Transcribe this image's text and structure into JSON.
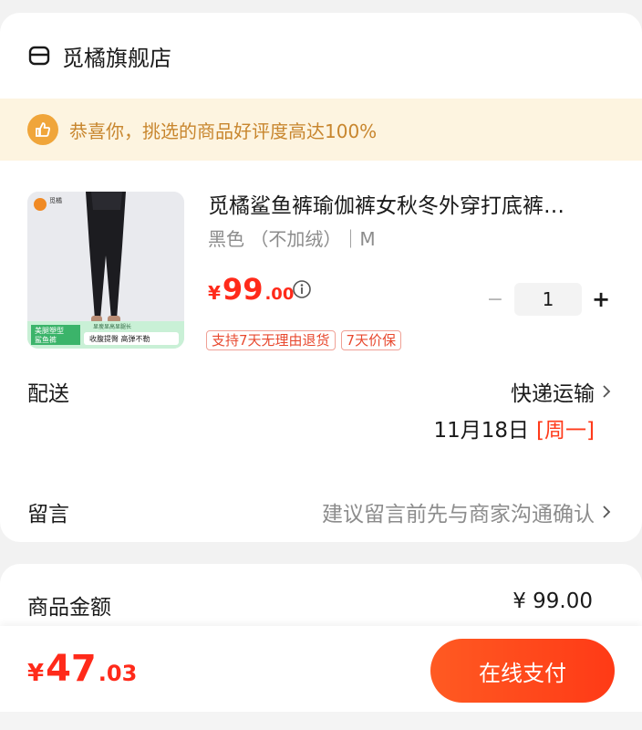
{
  "store": {
    "name": "觅橘旗舰店"
  },
  "banner": {
    "text": "恭喜你，挑选的商品好评度高达100%"
  },
  "product": {
    "title": "觅橘鲨鱼裤瑜伽裤女秋冬外穿打底裤…",
    "spec": "黑色 （不加绒）｜M",
    "image_brand": "觅橘",
    "image_text_left_1": "美腿塑型",
    "image_text_left_2": "鲨鱼裤",
    "image_text_top": "显瘦显高显腿长",
    "image_text_bottom": "收腹提臀 高弹不勒",
    "price_currency": "¥",
    "price_int": "99",
    "price_dec": ".00",
    "quantity": "1",
    "minus": "−",
    "plus": "+",
    "tags": [
      "支持7天无理由退货",
      "7天价保"
    ]
  },
  "delivery": {
    "label": "配送",
    "method": "快递运输",
    "date": "11月18日",
    "day": "[周一]"
  },
  "message": {
    "label": "留言",
    "placeholder": "建议留言前先与商家沟通确认"
  },
  "amount": {
    "label": "商品金额",
    "value": "¥ 99.00"
  },
  "footer": {
    "total_currency": "¥",
    "total_int": "47",
    "total_dec": ".03",
    "pay_label": "在线支付"
  },
  "colors": {
    "accent": "#ff3a16",
    "banner_bg": "#fdf4e0",
    "banner_text": "#c8862e"
  }
}
